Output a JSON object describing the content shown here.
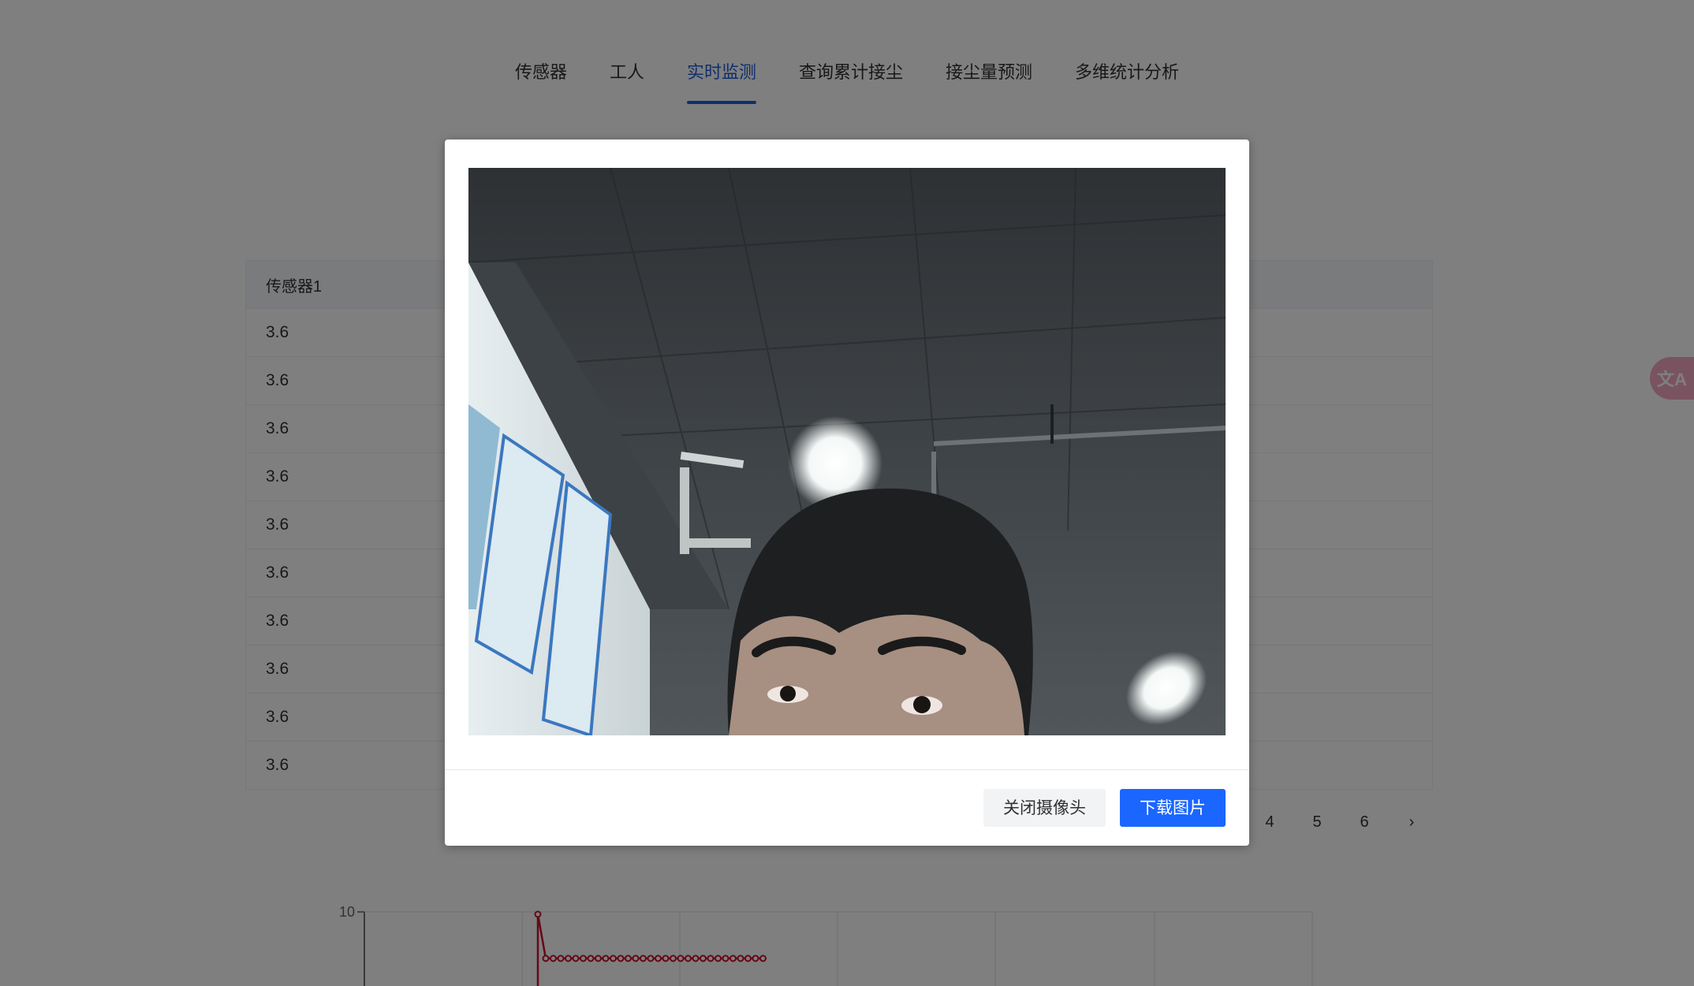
{
  "tabs": [
    {
      "label": "传感器"
    },
    {
      "label": "工人"
    },
    {
      "label": "实时监测",
      "active": true
    },
    {
      "label": "查询累计接尘"
    },
    {
      "label": "接尘量预测"
    },
    {
      "label": "多维统计分析"
    }
  ],
  "table": {
    "header": "传感器1",
    "rows": [
      "3.6",
      "3.6",
      "3.6",
      "3.6",
      "3.6",
      "3.6",
      "3.6",
      "3.6",
      "3.6",
      "3.6"
    ]
  },
  "pagination": {
    "pages": [
      "4",
      "5",
      "6"
    ],
    "next": "›"
  },
  "chart_data": {
    "type": "line",
    "y_tick_label": "10",
    "series_color": "#c8102e"
  },
  "dialog": {
    "close_camera_label": "关闭摄像头",
    "download_label": "下载图片"
  },
  "translate_button": {
    "label": "文A",
    "color": "#f4a7c3"
  },
  "colors": {
    "accent": "#1f5fd8",
    "primary_button": "#1a66ff"
  }
}
